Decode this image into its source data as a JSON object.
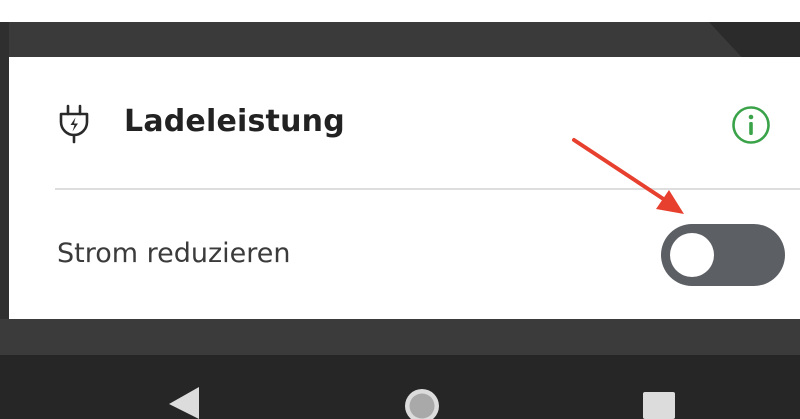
{
  "colors": {
    "accent_green": "#3aa34a",
    "arrow_red": "#e8402e",
    "toggle_track": "#5c5f63",
    "toggle_knob": "#ffffff",
    "nav_bar": "#262626"
  },
  "icons": {
    "section": "plug-icon",
    "info": "info-icon",
    "nav": [
      "back-icon",
      "home-icon",
      "recent-apps-icon"
    ]
  },
  "section": {
    "title": "Ladeleistung"
  },
  "setting": {
    "label": "Strom reduzieren",
    "enabled": false
  }
}
